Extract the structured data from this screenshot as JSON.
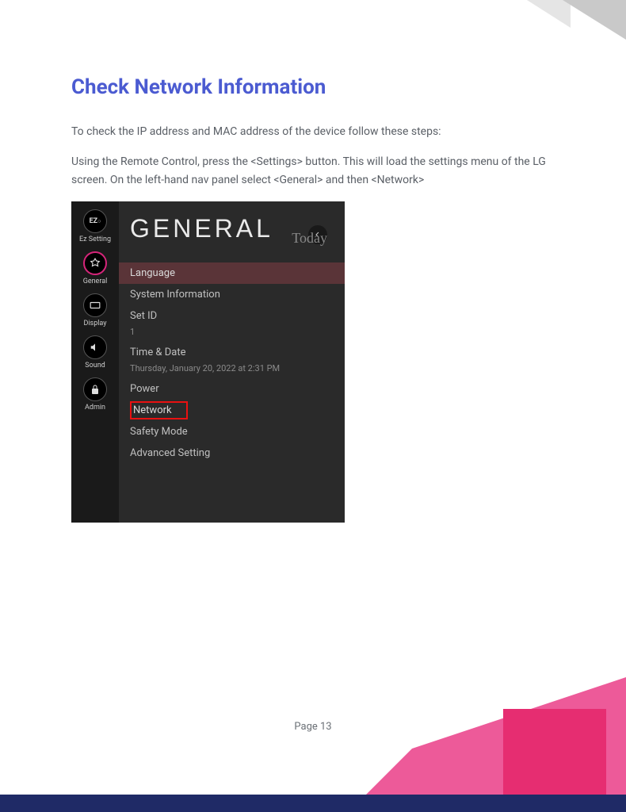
{
  "heading": "Check Network Information",
  "para1": "To check the IP address and MAC address of the device follow these steps:",
  "para2": "Using the Remote Control, press the <Settings> button. This will load the settings menu of the LG screen. On the left-hand nav panel select <General> and then <Network>",
  "page_label": "Page 13",
  "lg": {
    "title": "GENERAL",
    "today": "Today",
    "nav": [
      {
        "icon": "EZ",
        "label": "Ez Setting"
      },
      {
        "icon": "G",
        "label": "General"
      },
      {
        "icon": "D",
        "label": "Display"
      },
      {
        "icon": "S",
        "label": "Sound"
      },
      {
        "icon": "A",
        "label": "Admin"
      }
    ],
    "language": "Language",
    "system_info": "System Information",
    "set_id": "Set ID",
    "set_id_val": "1",
    "time_date": "Time & Date",
    "time_date_val": "Thursday, January 20, 2022 at 2:31 PM",
    "power": "Power",
    "network": "Network",
    "safety": "Safety Mode",
    "advanced": "Advanced Setting"
  }
}
